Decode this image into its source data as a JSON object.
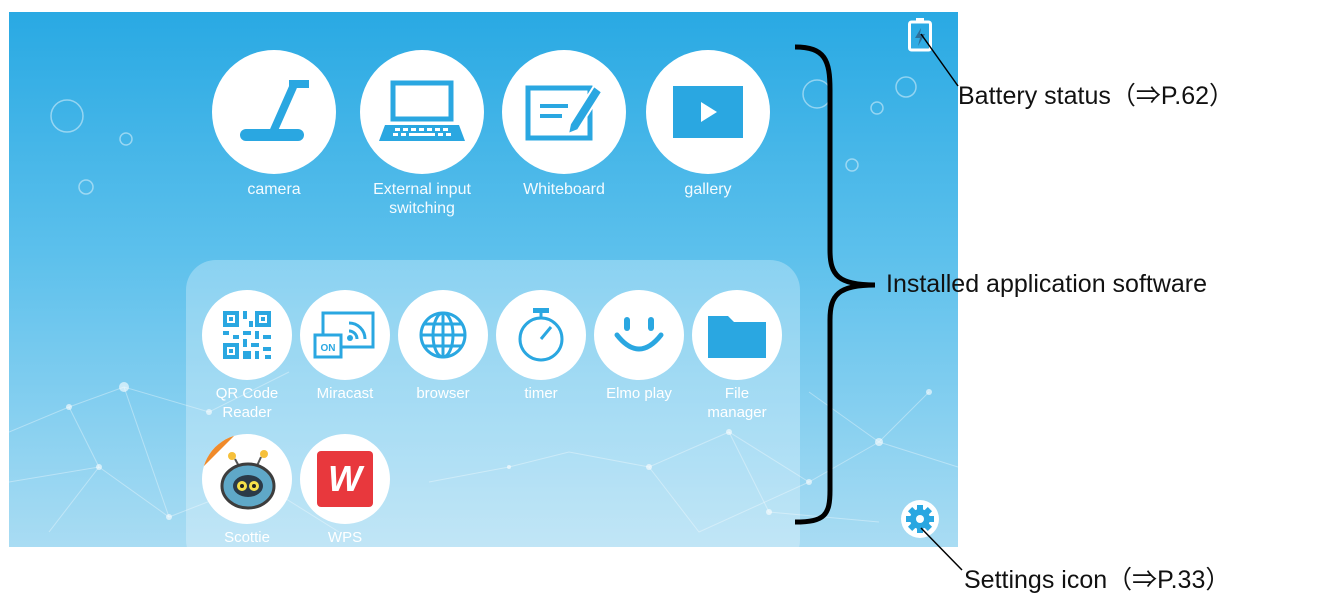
{
  "home": {
    "main_apps": [
      {
        "label": "camera",
        "icon": "document-camera-icon"
      },
      {
        "label": "External input\nswitching",
        "icon": "laptop-icon"
      },
      {
        "label": "Whiteboard",
        "icon": "whiteboard-icon"
      },
      {
        "label": "gallery",
        "icon": "play-icon"
      }
    ],
    "installed_apps": [
      {
        "label": "QR Code\nReader",
        "icon": "qr-code-icon"
      },
      {
        "label": "Miracast",
        "icon": "miracast-icon",
        "badge": "ON"
      },
      {
        "label": "browser",
        "icon": "globe-icon"
      },
      {
        "label": "timer",
        "icon": "stopwatch-icon"
      },
      {
        "label": "Elmo play",
        "icon": "smiley-icon"
      },
      {
        "label": "File\nmanager",
        "icon": "folder-icon"
      },
      {
        "label": "Scottie\nGo! Edu",
        "icon": "robot-icon"
      },
      {
        "label": "WPS\nOffice",
        "icon": "wps-icon",
        "logo_text": "W"
      }
    ],
    "status": {
      "battery_icon": "battery-icon",
      "settings_icon": "gear-icon"
    }
  },
  "callouts": {
    "battery": "Battery status（⇒P.62）",
    "installed": "Installed application software",
    "settings": "Settings icon（⇒P.33）"
  },
  "colors": {
    "sky": "#29a9e3",
    "icon_blue": "#2aa7e1",
    "wps_red": "#e8383d",
    "bracket": "#000000"
  }
}
